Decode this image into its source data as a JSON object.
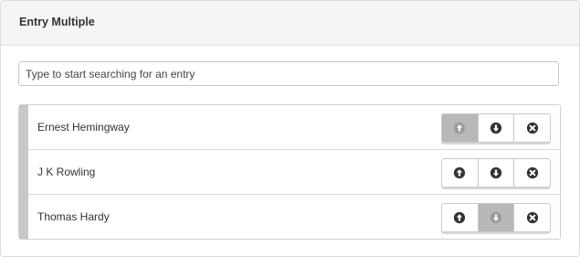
{
  "panel": {
    "title": "Entry Multiple"
  },
  "search": {
    "placeholder": "Type to start searching for an entry",
    "value": ""
  },
  "entries": [
    {
      "label": "Ernest Hemingway",
      "up_disabled": true,
      "down_disabled": false
    },
    {
      "label": "J K Rowling",
      "up_disabled": false,
      "down_disabled": false
    },
    {
      "label": "Thomas Hardy",
      "up_disabled": false,
      "down_disabled": true
    }
  ],
  "icons": {
    "up": "arrow-up-circle-icon",
    "down": "arrow-down-circle-icon",
    "remove": "close-circle-icon"
  },
  "colors": {
    "icon": "#333333",
    "icon_disabled": "#9a9a9a",
    "button_disabled_bg": "#b8b8b8"
  }
}
